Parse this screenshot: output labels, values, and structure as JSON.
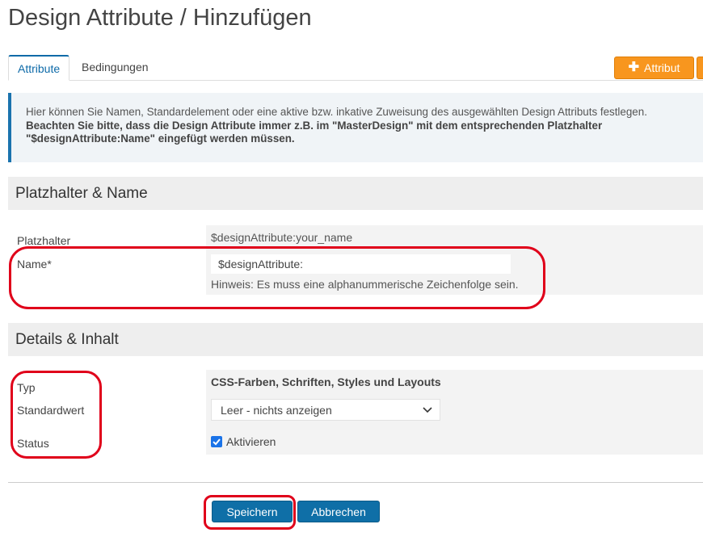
{
  "page": {
    "title": "Design Attribute / Hinzufügen"
  },
  "tabs": [
    {
      "label": "Attribute",
      "active": true
    },
    {
      "label": "Bedingungen",
      "active": false
    }
  ],
  "toolbar": {
    "add_label": "Attribut",
    "add_icon": "plus-icon"
  },
  "info": {
    "line1": "Hier können Sie Namen, Standardelement oder eine aktive bzw. inkative Zuweisung des ausgewählten Design Attributs festlegen.",
    "line2": "Beachten Sie bitte, dass die Design Attribute immer z.B. im \"MasterDesign\" mit dem entsprechenden Platzhalter",
    "line3": "\"$designAttribute:Name\" eingefügt werden müssen."
  },
  "section_placeholder": {
    "title": "Platzhalter & Name",
    "placeholder_label": "Platzhalter",
    "placeholder_value": "$designAttribute:your_name",
    "name_label": "Name*",
    "name_prefix": "$designAttribute:",
    "name_hint": "Hinweis: Es muss eine alphanummerische Zeichenfolge sein."
  },
  "section_details": {
    "title": "Details & Inhalt",
    "type_label": "Typ",
    "type_value": "CSS-Farben, Schriften, Styles und Layouts",
    "default_label": "Standardwert",
    "default_value": "Leer - nichts anzeigen",
    "status_label": "Status",
    "status_checkbox_label": "Aktivieren",
    "status_checked": true
  },
  "actions": {
    "save_label": "Speichern",
    "cancel_label": "Abbrechen"
  },
  "colors": {
    "primary": "#0f6fa7",
    "accent": "#f8961e",
    "annotation": "#e0001a",
    "info_border": "#1a73ae"
  }
}
